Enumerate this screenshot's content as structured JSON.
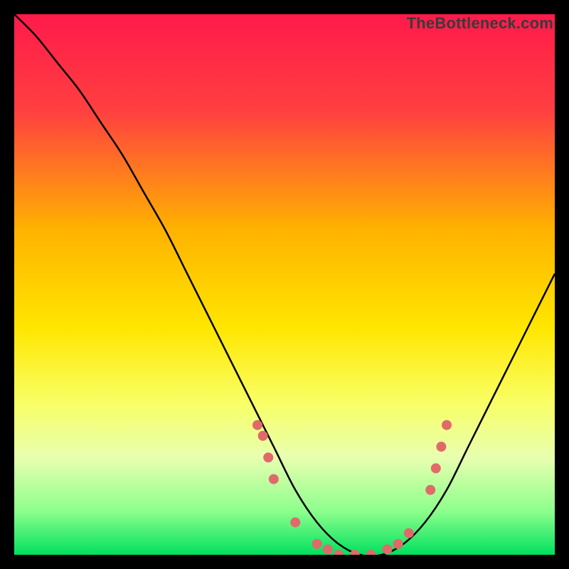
{
  "watermark": "TheBottleneck.com",
  "chart_data": {
    "type": "line",
    "title": "",
    "xlabel": "",
    "ylabel": "",
    "xlim": [
      0,
      100
    ],
    "ylim": [
      0,
      100
    ],
    "gradient_stops": [
      {
        "offset": 0,
        "color": "#ff1a4b"
      },
      {
        "offset": 18,
        "color": "#ff4040"
      },
      {
        "offset": 40,
        "color": "#ffb300"
      },
      {
        "offset": 58,
        "color": "#ffe600"
      },
      {
        "offset": 72,
        "color": "#f8ff66"
      },
      {
        "offset": 82,
        "color": "#e8ffb0"
      },
      {
        "offset": 92,
        "color": "#8cff8c"
      },
      {
        "offset": 100,
        "color": "#00e05e"
      }
    ],
    "series": [
      {
        "name": "bottleneck-curve",
        "x": [
          0,
          4,
          8,
          12,
          16,
          20,
          24,
          28,
          32,
          36,
          40,
          44,
          48,
          52,
          56,
          60,
          64,
          68,
          72,
          76,
          80,
          84,
          88,
          92,
          96,
          100
        ],
        "y": [
          100,
          96,
          91,
          86,
          80,
          74,
          67,
          60,
          52,
          44,
          36,
          28,
          20,
          12,
          6,
          2,
          0,
          0,
          2,
          6,
          12,
          20,
          28,
          36,
          44,
          52
        ]
      }
    ],
    "scatter_points": {
      "name": "highlight-dots",
      "color": "#e06a6a",
      "x": [
        45,
        46,
        47,
        48,
        52,
        56,
        58,
        60,
        63,
        66,
        69,
        71,
        73,
        77,
        78,
        79,
        80
      ],
      "y": [
        24,
        22,
        18,
        14,
        6,
        2,
        1,
        0,
        0,
        0,
        1,
        2,
        4,
        12,
        16,
        20,
        24
      ]
    }
  }
}
